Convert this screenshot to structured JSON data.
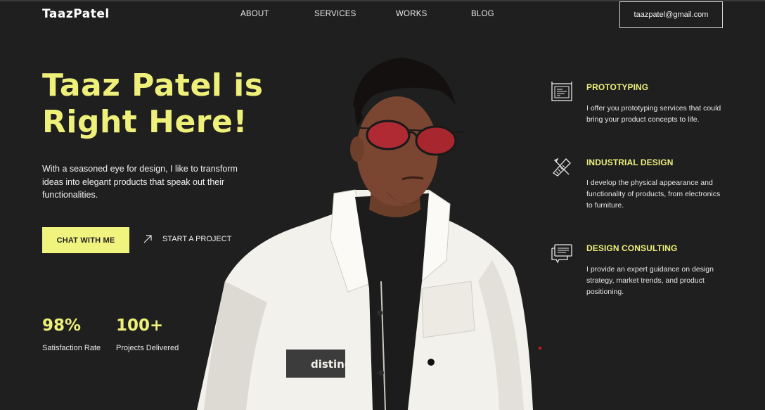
{
  "brand": {
    "logo": "TaazPatel"
  },
  "nav": {
    "items": [
      {
        "label": "ABOUT"
      },
      {
        "label": "SERVICES"
      },
      {
        "label": "WORKS"
      },
      {
        "label": "BLOG"
      }
    ],
    "email": "taazpatel@gmail.com"
  },
  "hero": {
    "headline_line1": "Taaz Patel is",
    "headline_line2": "Right Here!",
    "intro_line1": "With a seasoned eye for design, I like to transform",
    "intro_line2": "ideas into elegant products that speak out their",
    "intro_line3": "functionalities.",
    "cta_label": "CHAT WITH ME",
    "project_label": "START A PROJECT",
    "portrait_badge_text": "distinc"
  },
  "stats": [
    {
      "value": "98%",
      "label": "Satisfaction Rate"
    },
    {
      "value": "100+",
      "label": "Projects Delivered"
    }
  ],
  "services": [
    {
      "icon": "blueprint-icon",
      "title": "PROTOTYPING",
      "desc_line1": "I offer you prototyping services that could",
      "desc_line2": "bring your product concepts to life."
    },
    {
      "icon": "ruler-pencil-icon",
      "title": "INDUSTRIAL DESIGN",
      "desc_line1": "I develop the physical appearance and",
      "desc_line2": "functionality of products, from electronics",
      "desc_line3": "to furniture."
    },
    {
      "icon": "chat-bubbles-icon",
      "title": "DESIGN CONSULTING",
      "desc_line1": "I provide an expert guidance on design",
      "desc_line2": "strategy, market trends, and product",
      "desc_line3": "positioning."
    }
  ],
  "colors": {
    "background": "#1f1f1f",
    "accent": "#eef07a",
    "button": "#f0f47f",
    "text": "#ffffff",
    "jacket": "#f2f1ec",
    "shirt": "#1c1c1c",
    "lens": "#b02a34"
  }
}
